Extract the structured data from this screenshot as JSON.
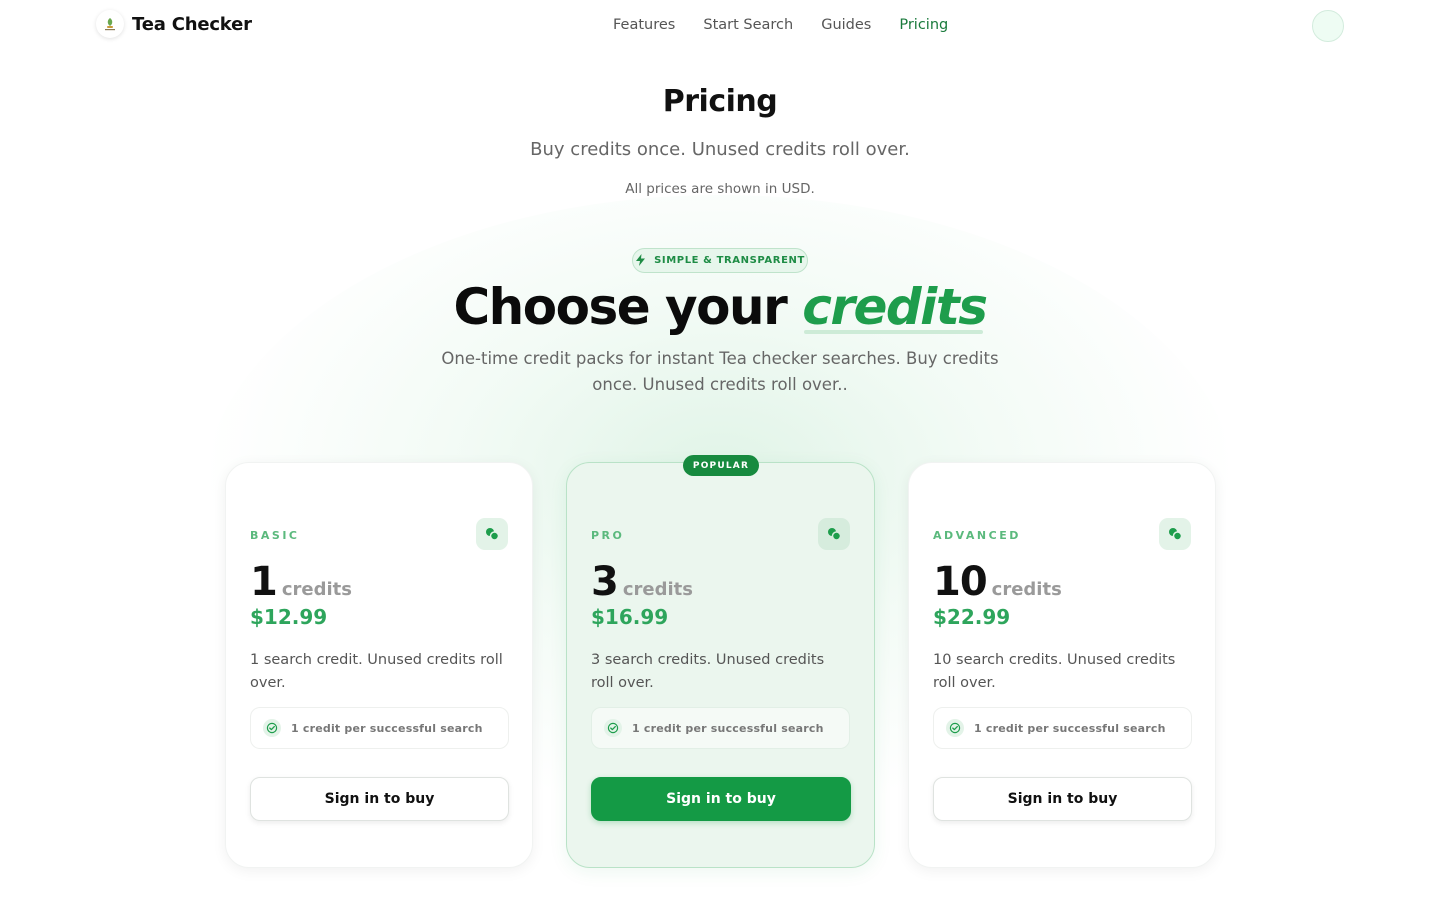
{
  "app": {
    "brand_name": "Tea Checker",
    "logo_icon": "tea-leaf-logo",
    "accent_color": "#1e9d4c"
  },
  "nav": {
    "items": [
      {
        "label": "Features",
        "active": false
      },
      {
        "label": "Start Search",
        "active": false
      },
      {
        "label": "Guides",
        "active": false
      },
      {
        "label": "Pricing",
        "active": true
      }
    ]
  },
  "page": {
    "title": "Pricing",
    "subtitle": "Buy credits once. Unused credits roll over.",
    "note": "All prices are shown in USD."
  },
  "hero": {
    "badge": "SIMPLE & TRANSPARENT",
    "badge_icon": "lightning-icon",
    "title_prefix": "Choose your",
    "title_accent": "credits",
    "subtitle": "One-time credit packs for instant Tea checker searches. Buy credits once. Unused credits roll over.."
  },
  "plans": [
    {
      "tier": "BASIC",
      "credits": "1",
      "credits_label": "credits",
      "price": "$12.99",
      "description": "1 search credit. Unused credits roll over.",
      "feature": "1 credit per successful search",
      "cta": "Sign in to buy",
      "popular": false
    },
    {
      "tier": "PRO",
      "credits": "3",
      "credits_label": "credits",
      "price": "$16.99",
      "description": "3 search credits. Unused credits roll over.",
      "feature": "1 credit per successful search",
      "cta": "Sign in to buy",
      "popular": true,
      "popular_label": "POPULAR"
    },
    {
      "tier": "ADVANCED",
      "credits": "10",
      "credits_label": "credits",
      "price": "$22.99",
      "description": "10 search credits. Unused credits roll over.",
      "feature": "1 credit per successful search",
      "cta": "Sign in to buy",
      "popular": false
    }
  ]
}
